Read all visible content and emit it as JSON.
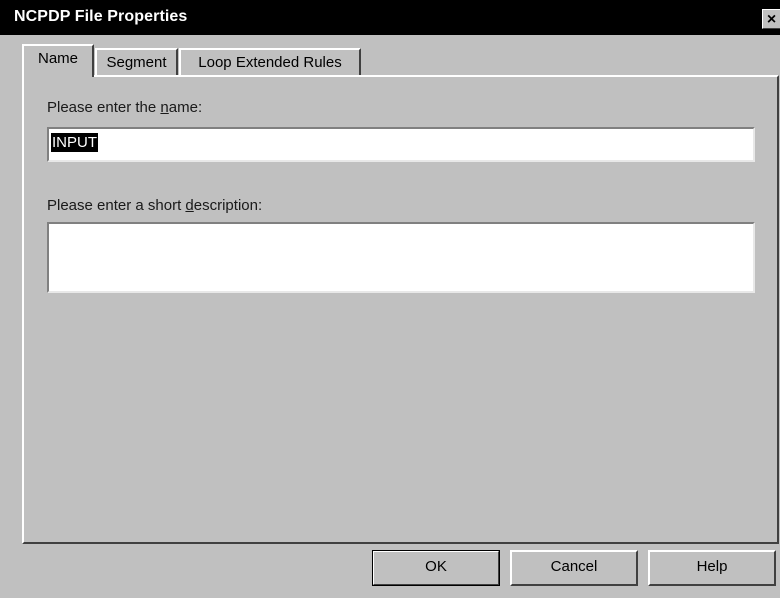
{
  "window": {
    "title": "NCPDP File Properties",
    "close_glyph": "×"
  },
  "tabs": [
    {
      "label": "Name",
      "active": true
    },
    {
      "label": "Segment",
      "active": false
    },
    {
      "label": "Loop Extended Rules",
      "active": false
    }
  ],
  "name_section": {
    "label_pre": "Please enter the ",
    "label_mnemonic": "n",
    "label_post": "ame:",
    "value": "INPUT"
  },
  "description_section": {
    "label_pre": "Please enter a short ",
    "label_mnemonic": "d",
    "label_post": "escription:",
    "value": ""
  },
  "buttons": {
    "ok": "OK",
    "cancel": "Cancel",
    "help": "Help"
  }
}
